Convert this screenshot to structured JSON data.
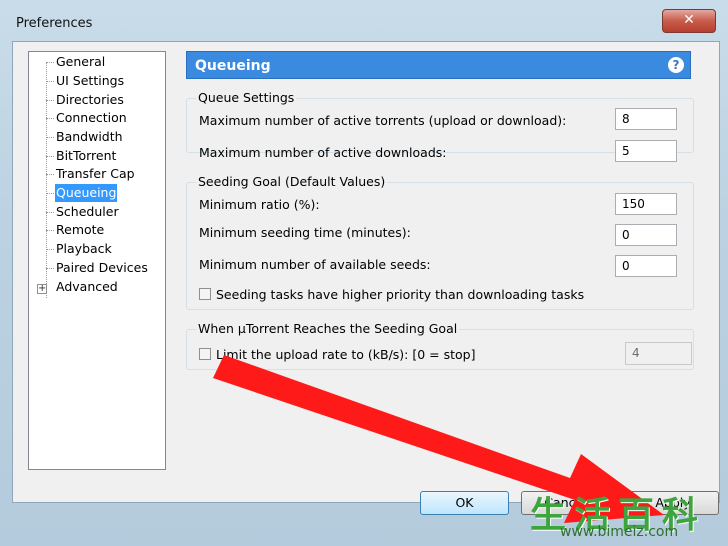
{
  "window": {
    "title": "Preferences",
    "close_label": "✕"
  },
  "sidebar": {
    "items": [
      {
        "label": "General"
      },
      {
        "label": "UI Settings"
      },
      {
        "label": "Directories"
      },
      {
        "label": "Connection"
      },
      {
        "label": "Bandwidth"
      },
      {
        "label": "BitTorrent"
      },
      {
        "label": "Transfer Cap"
      },
      {
        "label": "Queueing",
        "selected": true
      },
      {
        "label": "Scheduler"
      },
      {
        "label": "Remote"
      },
      {
        "label": "Playback"
      },
      {
        "label": "Paired Devices"
      },
      {
        "label": "Advanced",
        "expandable": true
      }
    ],
    "expander_glyph": "+"
  },
  "panel": {
    "title": "Queueing",
    "help_label": "?"
  },
  "queue_settings": {
    "title": "Queue Settings",
    "max_active_torrents_label": "Maximum number of active torrents (upload or download):",
    "max_active_torrents_value": "8",
    "max_active_downloads_label": "Maximum number of active downloads:",
    "max_active_downloads_value": "5"
  },
  "seeding_goal": {
    "title": "Seeding Goal (Default Values)",
    "min_ratio_label": "Minimum ratio (%):",
    "min_ratio_value": "150",
    "min_seeding_time_label": "Minimum seeding time (minutes):",
    "min_seeding_time_value": "0",
    "min_seeds_label": "Minimum number of available seeds:",
    "min_seeds_value": "0",
    "priority_checkbox_label": "Seeding tasks have higher priority than downloading tasks",
    "priority_checked": false
  },
  "goal_reached": {
    "title": "When µTorrent Reaches the Seeding Goal",
    "limit_checkbox_label": "Limit the upload rate to (kB/s): [0 = stop]",
    "limit_checked": false,
    "limit_value": "4"
  },
  "buttons": {
    "ok": "OK",
    "cancel": "Cancel",
    "apply": "Apply"
  },
  "overlay": {
    "arrow_color": "#ff1a1a",
    "watermark_cn": "生活百科",
    "watermark_url": "www.bimeiz.com"
  }
}
